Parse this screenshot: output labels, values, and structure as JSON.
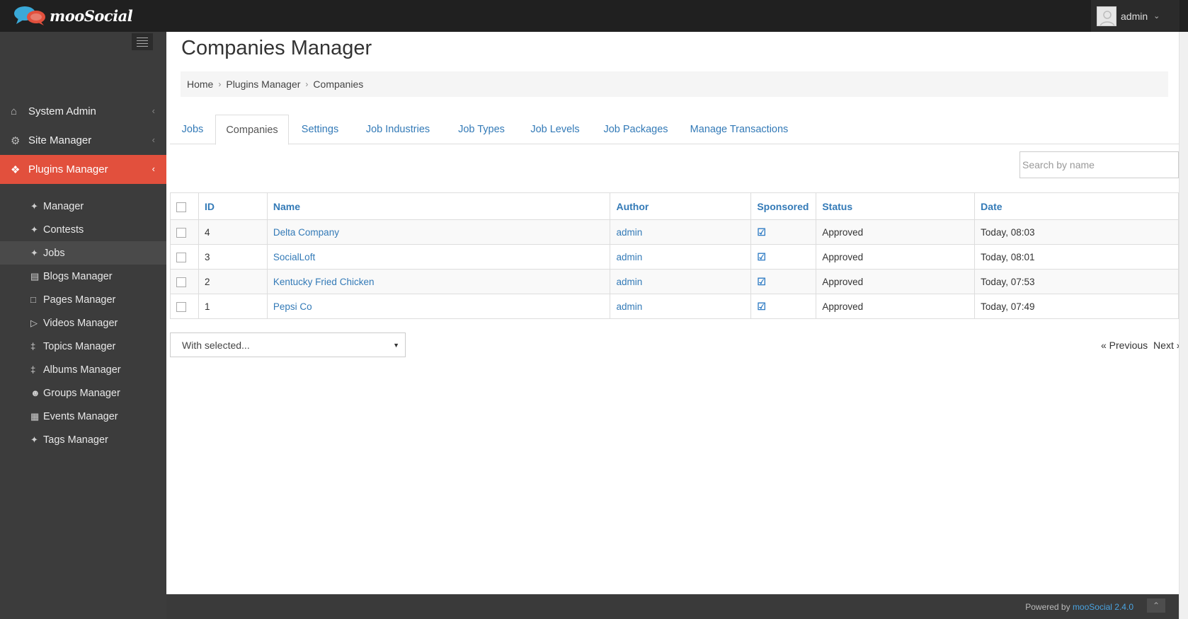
{
  "brand": {
    "name": "mooSocial"
  },
  "user": {
    "name": "admin"
  },
  "sidebar": {
    "main": [
      {
        "label": "System Admin",
        "icon": "home-icon"
      },
      {
        "label": "Site Manager",
        "icon": "gears-icon"
      },
      {
        "label": "Plugins Manager",
        "icon": "plugins-icon",
        "active": true
      }
    ],
    "sub": [
      {
        "label": "Manager",
        "icon": "tag-icon"
      },
      {
        "label": "Contests",
        "icon": "tag-icon"
      },
      {
        "label": "Jobs",
        "icon": "tag-icon",
        "active": true
      },
      {
        "label": "Blogs Manager",
        "icon": "blog-icon"
      },
      {
        "label": "Pages Manager",
        "icon": "page-icon"
      },
      {
        "label": "Videos Manager",
        "icon": "video-icon"
      },
      {
        "label": "Topics Manager",
        "icon": "topic-icon"
      },
      {
        "label": "Albums Manager",
        "icon": "album-icon"
      },
      {
        "label": "Groups Manager",
        "icon": "group-icon"
      },
      {
        "label": "Events Manager",
        "icon": "calendar-icon"
      },
      {
        "label": "Tags Manager",
        "icon": "tag-icon"
      }
    ]
  },
  "page": {
    "title": "Companies Manager"
  },
  "breadcrumb": [
    "Home",
    "Plugins Manager",
    "Companies"
  ],
  "tabs": [
    {
      "label": "Jobs"
    },
    {
      "label": "Companies",
      "active": true
    },
    {
      "label": "Settings"
    },
    {
      "label": "Job Industries"
    },
    {
      "label": "Job Types"
    },
    {
      "label": "Job Levels"
    },
    {
      "label": "Job Packages"
    },
    {
      "label": "Manage Transactions"
    }
  ],
  "search": {
    "placeholder": "Search by name"
  },
  "table": {
    "columns": [
      "ID",
      "Name",
      "Author",
      "Sponsored",
      "Status",
      "Date"
    ],
    "rows": [
      {
        "id": "4",
        "name": "Delta Company",
        "author": "admin",
        "sponsored": true,
        "status": "Approved",
        "date": "Today, 08:03"
      },
      {
        "id": "3",
        "name": "SocialLoft",
        "author": "admin",
        "sponsored": true,
        "status": "Approved",
        "date": "Today, 08:01"
      },
      {
        "id": "2",
        "name": "Kentucky Fried Chicken",
        "author": "admin",
        "sponsored": true,
        "status": "Approved",
        "date": "Today, 07:53"
      },
      {
        "id": "1",
        "name": "Pepsi Co",
        "author": "admin",
        "sponsored": true,
        "status": "Approved",
        "date": "Today, 07:49"
      }
    ]
  },
  "bulk_action": {
    "label": "With selected..."
  },
  "pager": {
    "previous": "« Previous",
    "next": "Next »"
  },
  "footer": {
    "prefix": "Powered by",
    "brand": "mooSocial 2.4.0"
  },
  "colors": {
    "accent": "#e2503d",
    "link": "#337ab7",
    "topbar": "#202020",
    "sidebar": "#3c3c3c"
  }
}
